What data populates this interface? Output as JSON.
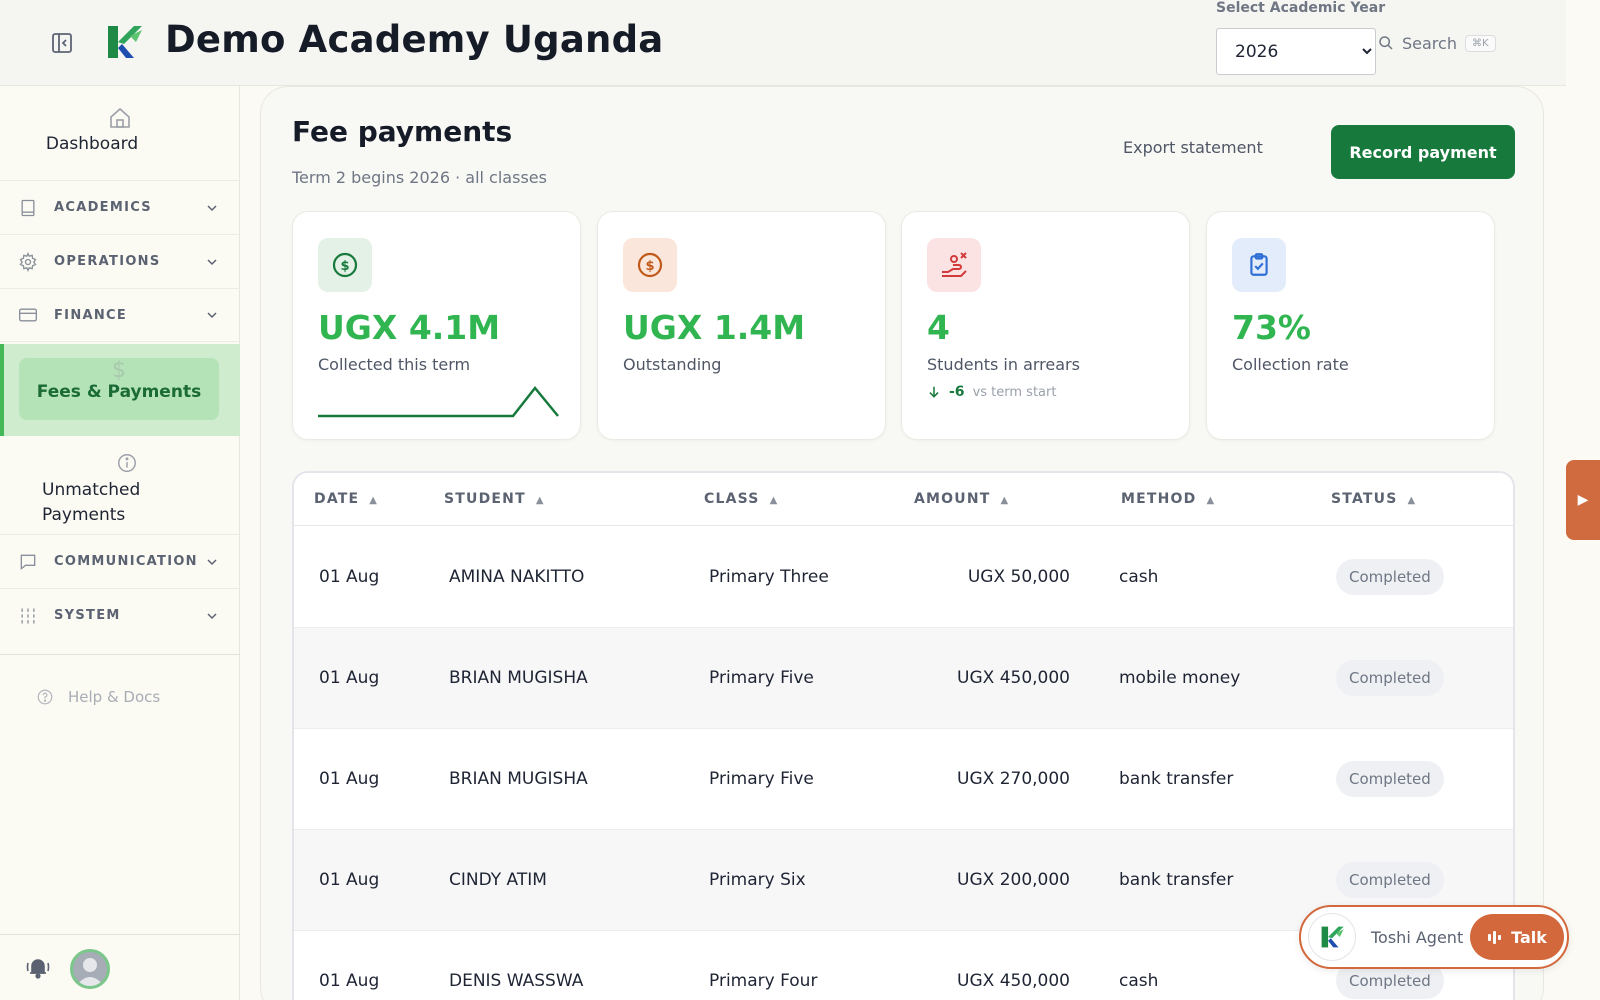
{
  "header": {
    "app_title": "Demo Academy Uganda",
    "year_label": "Select Academic Year",
    "year_selected": "2026",
    "search_label": "Search",
    "search_shortcut": "⌘K"
  },
  "sidebar": {
    "dashboard_label": "Dashboard",
    "sections": [
      {
        "label": "ACADEMICS",
        "icon": "book-icon"
      },
      {
        "label": "OPERATIONS",
        "icon": "gear-icon"
      },
      {
        "label": "FINANCE",
        "icon": "credit-card-icon"
      },
      {
        "label": "COMMUNICATION",
        "icon": "chat-icon"
      },
      {
        "label": "SYSTEM",
        "icon": "sliders-icon"
      }
    ],
    "active_item": {
      "label": "Fees & Payments",
      "glyph": "$"
    },
    "unmatched_label": "Unmatched Payments",
    "help_label": "Help & Docs"
  },
  "page": {
    "title": "Fee payments",
    "subtitle": "Term 2 begins 2026 · all classes",
    "export_label": "Export statement",
    "record_label": "Record payment"
  },
  "stats": [
    {
      "value": "UGX 4.1M",
      "caption": "Collected this term",
      "icon": "dollar-circle-icon",
      "accent": "#177a3c",
      "tint": "#e3f1e6"
    },
    {
      "value": "UGX 1.4M",
      "caption": "Outstanding",
      "icon": "dollar-circle-icon",
      "accent": "#c05a1a",
      "tint": "#fbe6dc"
    },
    {
      "value": "4",
      "caption": "Students in arrears",
      "icon": "hand-alert-icon",
      "accent": "#d33a3a",
      "tint": "#fbe3e3",
      "delta": "-6",
      "delta_context": "vs term start"
    },
    {
      "value": "73%",
      "caption": "Collection rate",
      "icon": "clipboard-check-icon",
      "accent": "#2f6fd6",
      "tint": "#e3ecfa"
    }
  ],
  "table": {
    "columns": [
      "DATE",
      "STUDENT",
      "CLASS",
      "AMOUNT",
      "METHOD",
      "STATUS"
    ],
    "sort_glyph": "▲",
    "rows": [
      {
        "date": "01 Aug",
        "student": "AMINA NAKITTO",
        "class": "Primary Three",
        "amount": "UGX 50,000",
        "method": "cash",
        "status": "Completed"
      },
      {
        "date": "01 Aug",
        "student": "BRIAN MUGISHA",
        "class": "Primary Five",
        "amount": "UGX 450,000",
        "method": "mobile money",
        "status": "Completed"
      },
      {
        "date": "01 Aug",
        "student": "BRIAN MUGISHA",
        "class": "Primary Five",
        "amount": "UGX 270,000",
        "method": "bank transfer",
        "status": "Completed"
      },
      {
        "date": "01 Aug",
        "student": "CINDY ATIM",
        "class": "Primary Six",
        "amount": "UGX 200,000",
        "method": "bank transfer",
        "status": "Completed"
      },
      {
        "date": "01 Aug",
        "student": "DENIS WASSWA",
        "class": "Primary Four",
        "amount": "UGX 450,000",
        "method": "cash",
        "status": "Completed"
      }
    ]
  },
  "agent": {
    "name": "Toshi Agent",
    "talk_label": "Talk"
  },
  "edge_tab_glyph": "▶",
  "colors": {
    "brand_green": "#177a3c",
    "accent_green": "#31b551",
    "agent_orange": "#d2683c"
  }
}
